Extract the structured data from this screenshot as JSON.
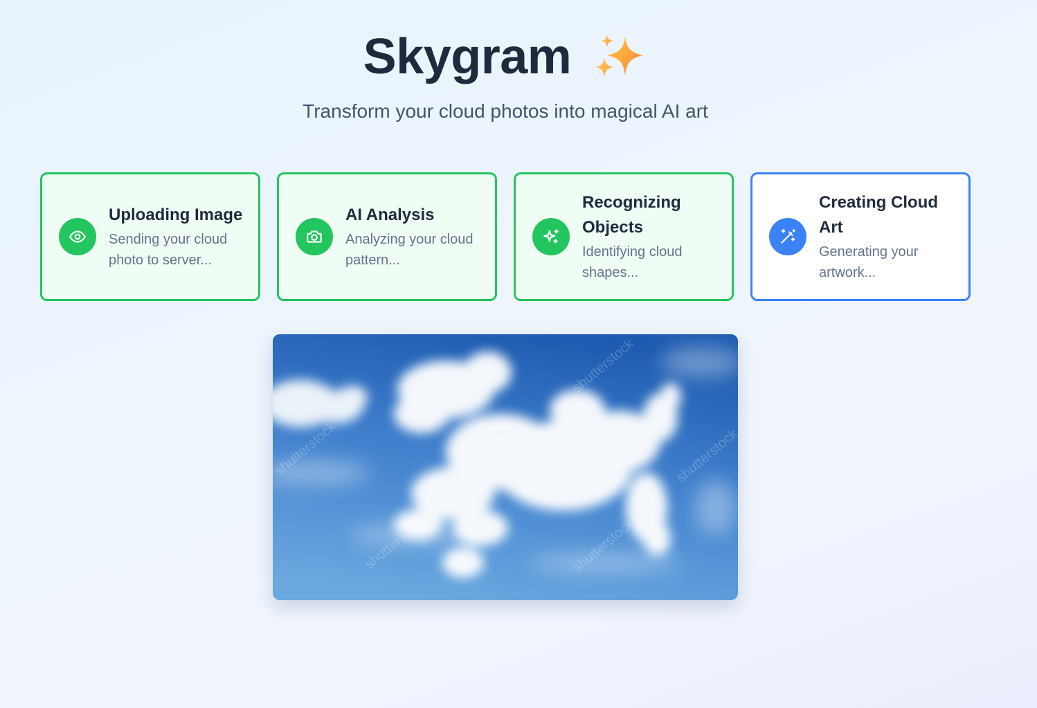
{
  "header": {
    "title": "Skygram",
    "sparkle_icon": "sparkles-emoji",
    "subtitle": "Transform your cloud photos into magical AI art"
  },
  "steps": [
    {
      "title": "Uploading Image",
      "description": "Sending your cloud photo to server...",
      "icon": "eye-icon",
      "state": "complete"
    },
    {
      "title": "AI Analysis",
      "description": "Analyzing your cloud pattern...",
      "icon": "camera-icon",
      "state": "complete"
    },
    {
      "title": "Recognizing Objects",
      "description": "Identifying cloud shapes...",
      "icon": "sparkles-icon",
      "state": "complete"
    },
    {
      "title": "Creating Cloud Art",
      "description": "Generating your artwork...",
      "icon": "magic-wand-icon",
      "state": "active"
    }
  ],
  "photo": {
    "subject": "cloud-photo",
    "watermark": "shutterstock"
  },
  "colors": {
    "complete": "#22c55e",
    "active": "#3b82f6",
    "complete_bg": "#f0fdf4",
    "title": "#1f2a3d",
    "text_muted": "#64748b"
  }
}
